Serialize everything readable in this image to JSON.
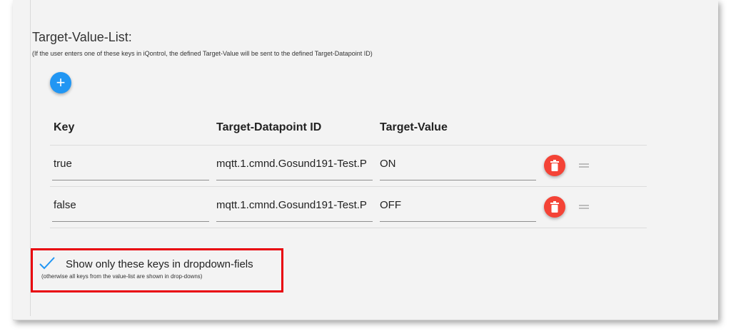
{
  "section": {
    "title": "Target-Value-List:",
    "hint": "(If the user enters one of these keys in iQontrol, the defined Target-Value will be sent to the defined Target-Datapoint ID)",
    "add_label": "+"
  },
  "table": {
    "headers": [
      "Key",
      "Target-Datapoint ID",
      "Target-Value"
    ],
    "rows": [
      {
        "key": "true",
        "datapoint": "mqtt.1.cmnd.Gosund191-Test.P",
        "value": "ON"
      },
      {
        "key": "false",
        "datapoint": "mqtt.1.cmnd.Gosund191-Test.P",
        "value": "OFF"
      }
    ]
  },
  "checkbox": {
    "label": "Show only these keys in dropdown-fiels",
    "hint": "(otherwise all keys from the value-list are shown in drop-downs)",
    "checked": true
  },
  "colors": {
    "add_button": "#2196f3",
    "delete_button": "#f44336",
    "highlight_border": "#e8000b",
    "checkmark": "#2196f3"
  },
  "icons": {
    "add": "plus-icon",
    "delete": "trash-icon",
    "reorder": "drag-handle-icon",
    "checkbox": "checkmark-icon"
  }
}
